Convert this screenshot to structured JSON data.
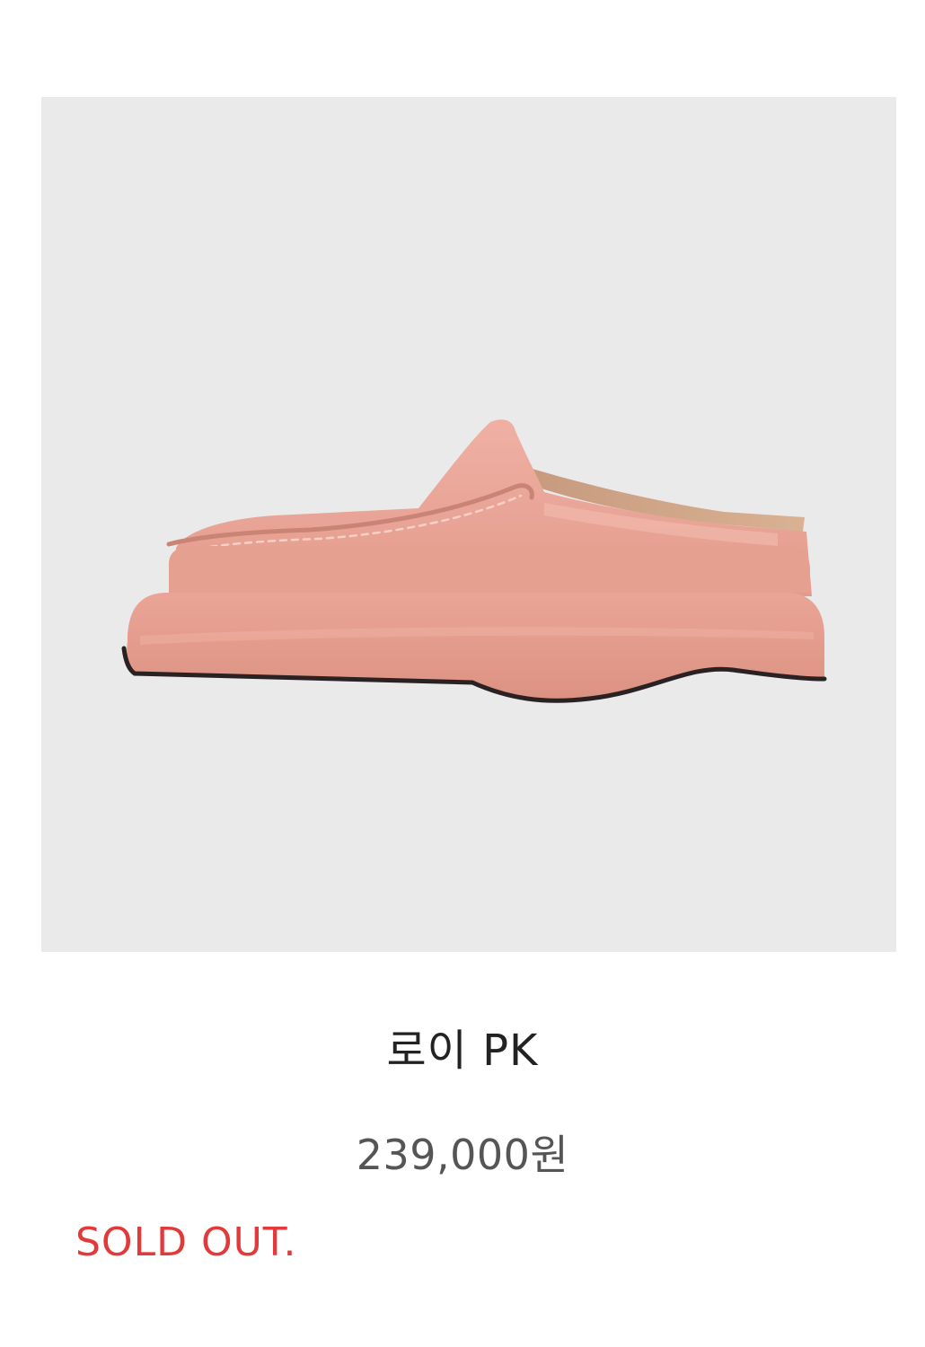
{
  "product": {
    "image_description_icon": "pink-suede-mule-shoe",
    "name": "로이 PK",
    "price": "239,000원",
    "status": "SOLD OUT."
  },
  "colors": {
    "image_background": "#eaeaeb",
    "shoe_body": "#e9a597",
    "shoe_shadow": "#d88e80",
    "shoe_highlight": "#f1b4a7",
    "sole_edge": "#2a2222",
    "name_text": "#222222",
    "price_text": "#555555",
    "sold_out_text": "#e23a3a"
  }
}
